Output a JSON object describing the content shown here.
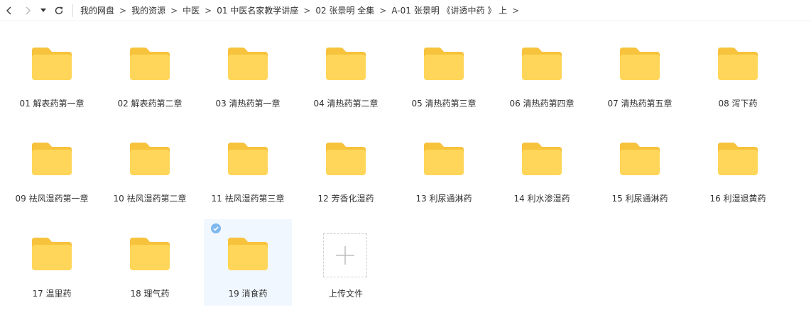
{
  "breadcrumb": [
    "我的网盘",
    "我的资源",
    "中医",
    "01 中医名家教学讲座",
    "02 张景明 全集",
    "A-01 张景明 《讲透中药 》 上"
  ],
  "breadcrumb_separator": ">",
  "folders": [
    "01 解表药第一章",
    "02 解表药第二章",
    "03 清热药第一章",
    "04 清热药第二章",
    "05 清热药第三章",
    "06 清热药第四章",
    "07 清热药第五章",
    "08 泻下药",
    "09 祛风湿药第一章",
    "10 祛风湿药第二章",
    "11 祛风湿药第三章",
    "12 芳香化湿药",
    "13 利尿通淋药",
    "14 利水渗湿药",
    "15 利尿通淋药",
    "16 利湿退黄药",
    "17 温里药",
    "18 理气药",
    "19 消食药"
  ],
  "selected_folder": "19 消食药",
  "upload_label": "上传文件",
  "colors": {
    "folder_body": "#FFD659",
    "folder_tab": "#F7C23C",
    "selected_bg": "#F0F7FE",
    "check": "#7EB8EE"
  }
}
